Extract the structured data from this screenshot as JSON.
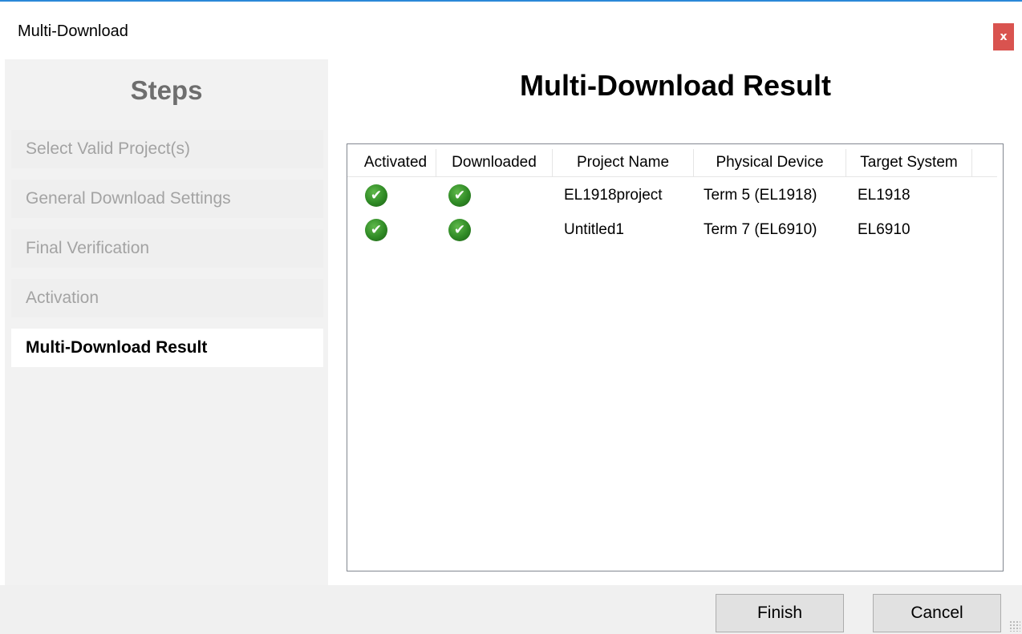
{
  "window": {
    "title": "Multi-Download",
    "close_label": "x"
  },
  "steps": {
    "header": "Steps",
    "items": [
      {
        "label": "Select Valid Project(s)"
      },
      {
        "label": "General Download Settings"
      },
      {
        "label": "Final Verification"
      },
      {
        "label": "Activation"
      },
      {
        "label": "Multi-Download Result"
      }
    ],
    "active_index": 4
  },
  "main": {
    "title": "Multi-Download Result",
    "table": {
      "columns": [
        "Activated",
        "Downloaded",
        "Project Name",
        "Physical Device",
        "Target System"
      ],
      "rows": [
        {
          "activated": "check-icon",
          "downloaded": "check-icon",
          "project_name": "EL1918project",
          "physical_device": "Term 5 (EL1918)",
          "target_system": "EL1918"
        },
        {
          "activated": "check-icon",
          "downloaded": "check-icon",
          "project_name": "Untitled1",
          "physical_device": "Term 7 (EL6910)",
          "target_system": "EL6910"
        }
      ]
    }
  },
  "footer": {
    "finish_label": "Finish",
    "cancel_label": "Cancel"
  },
  "colors": {
    "accent": "#2b88d8",
    "close": "#d9534f",
    "success": "#2f8a25"
  }
}
